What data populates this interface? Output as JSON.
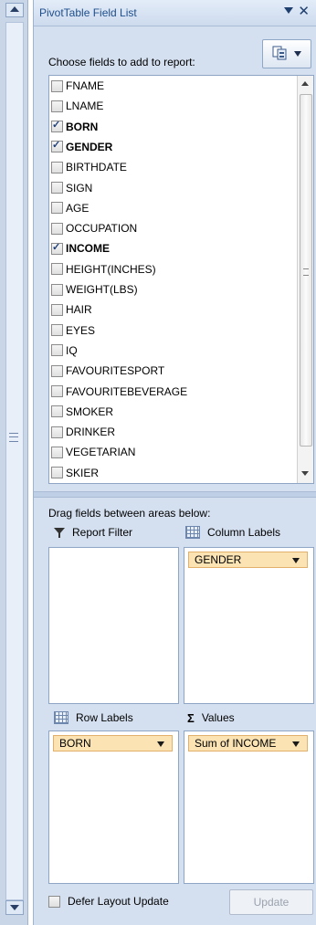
{
  "panel": {
    "title": "PivotTable Field List"
  },
  "chooser": {
    "label": "Choose fields to add to report:"
  },
  "fields": [
    {
      "label": "FNAME",
      "checked": false
    },
    {
      "label": "LNAME",
      "checked": false
    },
    {
      "label": "BORN",
      "checked": true
    },
    {
      "label": "GENDER",
      "checked": true
    },
    {
      "label": "BIRTHDATE",
      "checked": false
    },
    {
      "label": "SIGN",
      "checked": false
    },
    {
      "label": "AGE",
      "checked": false
    },
    {
      "label": "OCCUPATION",
      "checked": false
    },
    {
      "label": "INCOME",
      "checked": true
    },
    {
      "label": "HEIGHT(INCHES)",
      "checked": false
    },
    {
      "label": "WEIGHT(LBS)",
      "checked": false
    },
    {
      "label": "HAIR",
      "checked": false
    },
    {
      "label": "EYES",
      "checked": false
    },
    {
      "label": "IQ",
      "checked": false
    },
    {
      "label": "FAVOURITESPORT",
      "checked": false
    },
    {
      "label": "FAVOURITEBEVERAGE",
      "checked": false
    },
    {
      "label": "SMOKER",
      "checked": false
    },
    {
      "label": "DRINKER",
      "checked": false
    },
    {
      "label": "VEGETARIAN",
      "checked": false
    },
    {
      "label": "SKIER",
      "checked": false
    }
  ],
  "areas": {
    "instruction": "Drag fields between areas below:",
    "report_filter": {
      "label": "Report Filter",
      "items": []
    },
    "column_labels": {
      "label": "Column Labels",
      "items": [
        "GENDER"
      ]
    },
    "row_labels": {
      "label": "Row Labels",
      "items": [
        "BORN"
      ]
    },
    "values": {
      "label": "Values",
      "items": [
        "Sum of INCOME"
      ]
    }
  },
  "footer": {
    "defer_label": "Defer Layout Update",
    "defer_checked": false,
    "update_label": "Update"
  },
  "colors": {
    "panel_bg": "#d4e0f0",
    "title_text": "#1f4e8c",
    "chip_bg": "#fbe3b4",
    "chip_border": "#e2b06a"
  },
  "icons": {
    "close": "✕",
    "sigma": "Σ"
  }
}
